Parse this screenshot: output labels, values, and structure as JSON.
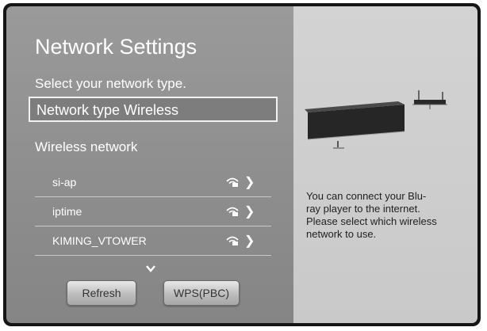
{
  "screen": {
    "title": "Network Settings",
    "subtitle": "Select your network type.",
    "network_type_label": "Network type  Wireless",
    "wireless_header": "Wireless network",
    "networks": [
      {
        "name": "si-ap",
        "icon": "wifi-lock-icon"
      },
      {
        "name": "iptime",
        "icon": "wifi-lock-icon"
      },
      {
        "name": "KIMING_VTOWER",
        "icon": "wifi-lock-icon"
      }
    ],
    "buttons": {
      "refresh": "Refresh",
      "wps": "WPS(PBC)"
    }
  },
  "help_panel": {
    "text": "You can connect your Blu-\nray player to the internet.\nPlease select which wireless\nnetwork to use."
  },
  "colors": {
    "left_panel": "#8f8f8f",
    "right_panel": "#cfcfcf",
    "frame": "#151515",
    "text_light": "#ffffff",
    "text_dark": "#222222"
  }
}
